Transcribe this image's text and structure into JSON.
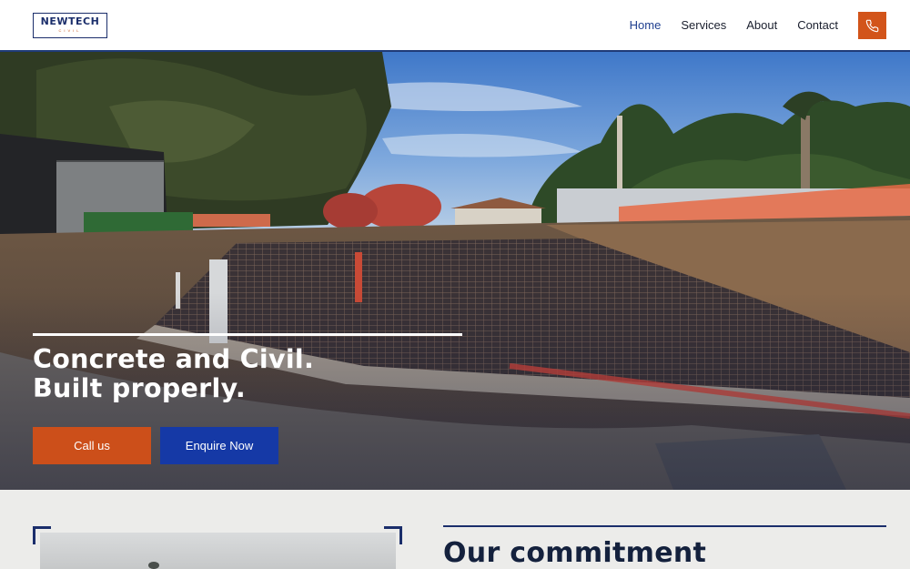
{
  "header": {
    "logo": {
      "main": "NEWTECH",
      "sub": "CIVIL"
    },
    "nav": [
      {
        "label": "Home",
        "active": true
      },
      {
        "label": "Services",
        "active": false
      },
      {
        "label": "About",
        "active": false
      },
      {
        "label": "Contact",
        "active": false
      }
    ],
    "phone_icon": "phone-icon"
  },
  "hero": {
    "title_line1": "Concrete and Civil.",
    "title_line2": "Built properly.",
    "call_label": "Call us",
    "enquire_label": "Enquire Now"
  },
  "section": {
    "title": "Our commitment"
  },
  "colors": {
    "brand_navy": "#1b2e6b",
    "accent_orange": "#d2541a",
    "button_blue": "#1539a6"
  }
}
